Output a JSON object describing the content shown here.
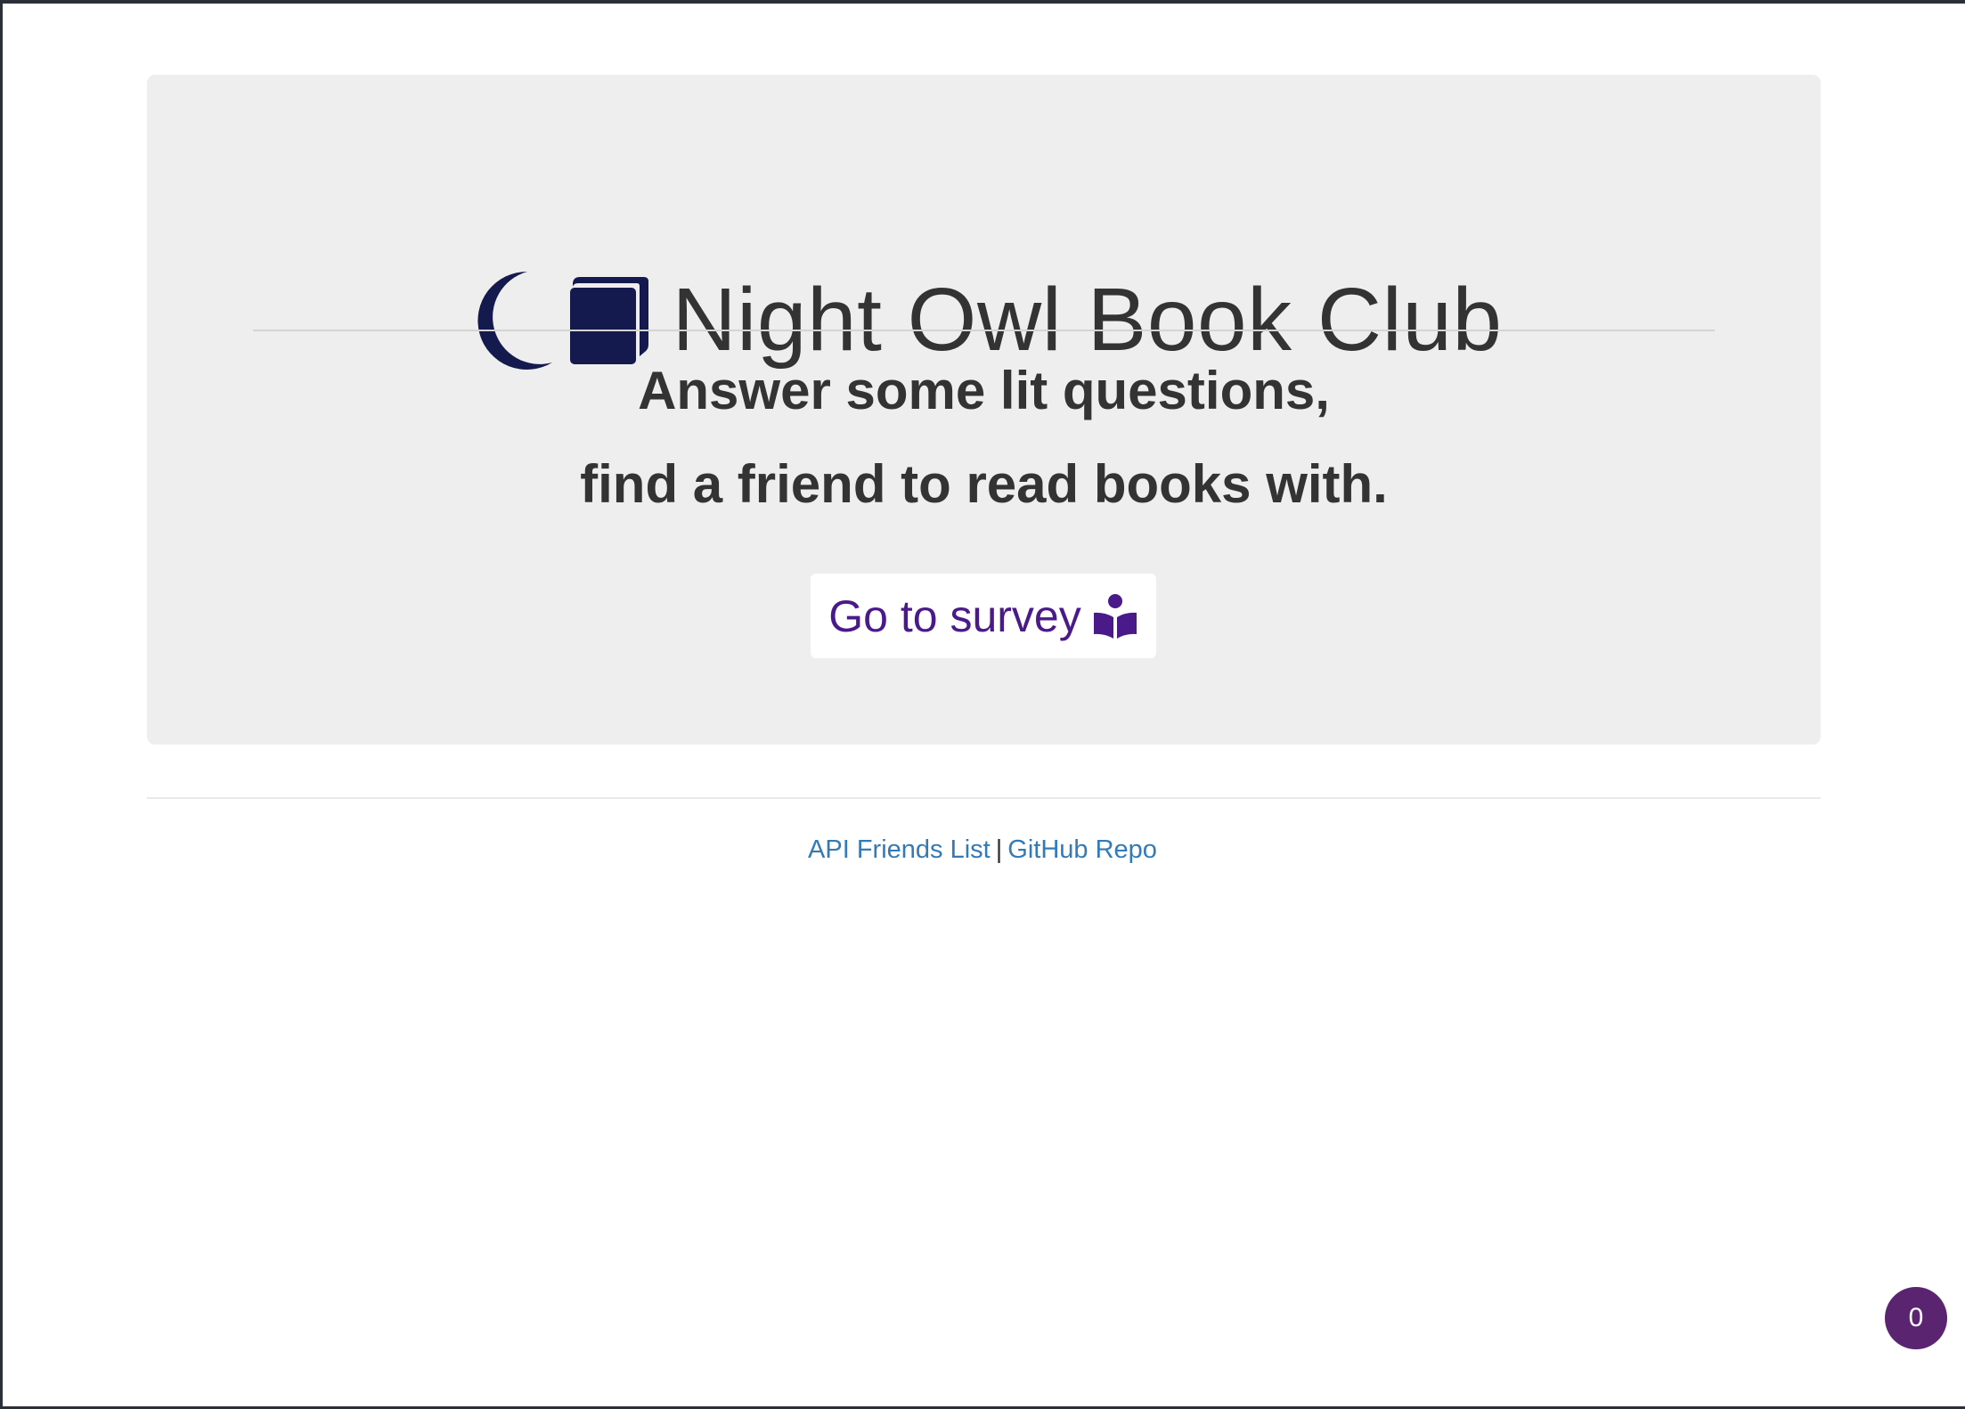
{
  "header": {
    "title": "Night Owl Book Club",
    "icons": [
      "moon-icon",
      "book-icon"
    ],
    "icon_color": "#141a4d"
  },
  "hero": {
    "subtitle_line1": "Answer some lit questions,",
    "subtitle_line2": "find a friend to read books with."
  },
  "survey_button": {
    "label": "Go to survey",
    "icon": "book-reader-icon",
    "color": "#4a1a8a"
  },
  "footer": {
    "links": [
      {
        "label": "API Friends List"
      },
      {
        "label": "GitHub Repo"
      }
    ],
    "separator": "|",
    "link_color": "#337ab7"
  },
  "badge": {
    "count": "0",
    "color": "#5b2470"
  }
}
